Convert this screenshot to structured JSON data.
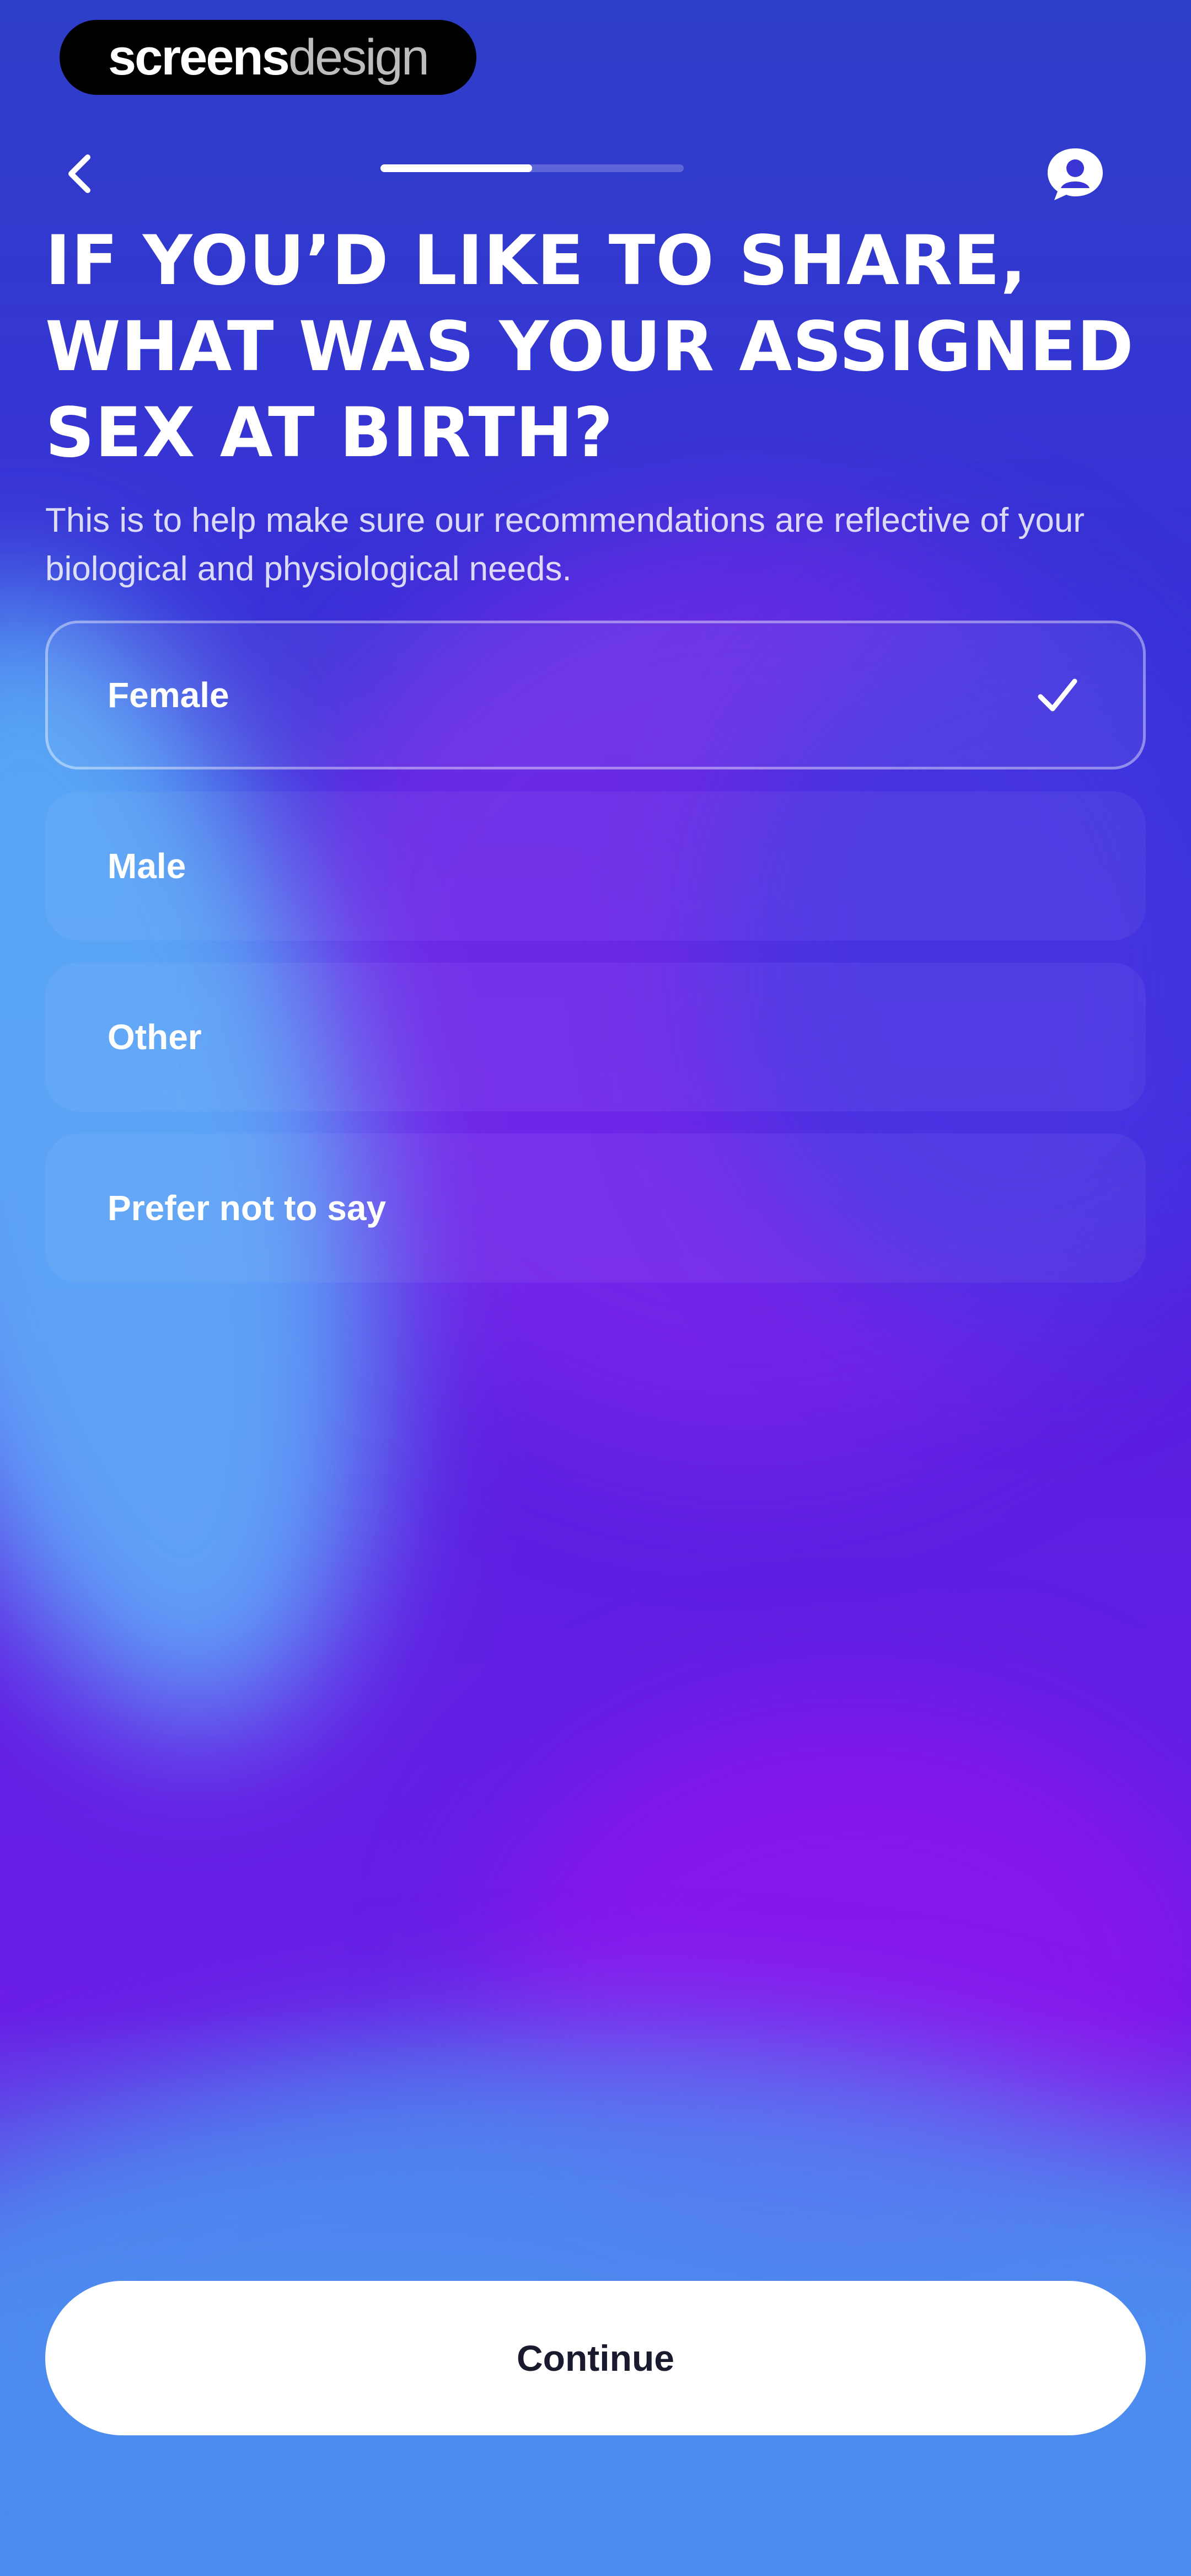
{
  "watermark": {
    "bold": "screens",
    "light": "design"
  },
  "nav": {
    "back_icon": "chevron-left-icon",
    "help_icon": "help-bubble-icon",
    "progress": 0.5
  },
  "question": {
    "title": "IF YOU’D LIKE TO SHARE, WHAT WAS YOUR ASSIGNED SEX AT BIRTH?",
    "subtitle": "This is to help make sure our recommendations are reflective of your biological and physiological needs."
  },
  "options": [
    {
      "label": "Female",
      "selected": true
    },
    {
      "label": "Male",
      "selected": false
    },
    {
      "label": "Other",
      "selected": false
    },
    {
      "label": "Prefer not to say",
      "selected": false
    }
  ],
  "continue_label": "Continue",
  "colors": {
    "background_top": "#2d3fc8",
    "background_mid": "#5a1fe0",
    "background_bottom": "#4a8df0",
    "accent_glow": "#60cdff",
    "button_bg": "#ffffff",
    "button_text": "#1a1a2e"
  }
}
